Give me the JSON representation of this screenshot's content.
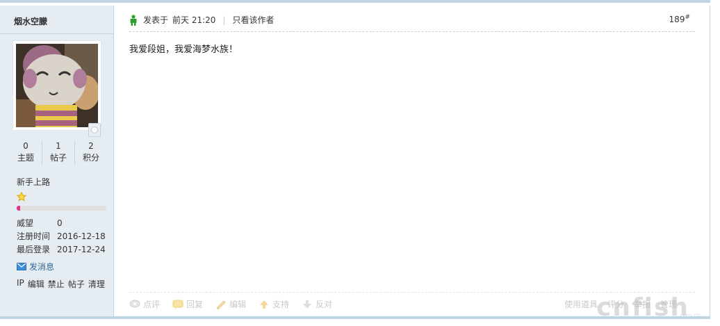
{
  "author": {
    "name": "烟水空朦",
    "stats": [
      {
        "value": "0",
        "label": "主题"
      },
      {
        "value": "1",
        "label": "帖子"
      },
      {
        "value": "2",
        "label": "积分"
      }
    ],
    "group": "新手上路",
    "level_progress": 0.04,
    "info": [
      {
        "key": "威望",
        "value": "0"
      },
      {
        "key": "注册时间",
        "value": "2016-12-18"
      },
      {
        "key": "最后登录",
        "value": "2017-12-24"
      }
    ],
    "send_message": "发消息",
    "admin_links": [
      "IP",
      "编辑",
      "禁止",
      "帖子",
      "清理"
    ]
  },
  "post": {
    "posted_at_prefix": "发表于",
    "posted_at": "前天 21:20",
    "separator": "|",
    "only_author": "只看该作者",
    "floor_number": "189",
    "floor_mark": "#",
    "content": "我爱段姐，我爱海梦水族！"
  },
  "actions": {
    "left": [
      "点评",
      "回复",
      "编辑",
      "支持",
      "反对"
    ],
    "right": [
      "使用道具",
      "评分",
      "举报",
      "管理"
    ]
  },
  "colors": {
    "sidebar_bg": "#e5edf2",
    "border": "#c2d5e3",
    "link": "#336699",
    "level_bar": "#e3348a"
  }
}
